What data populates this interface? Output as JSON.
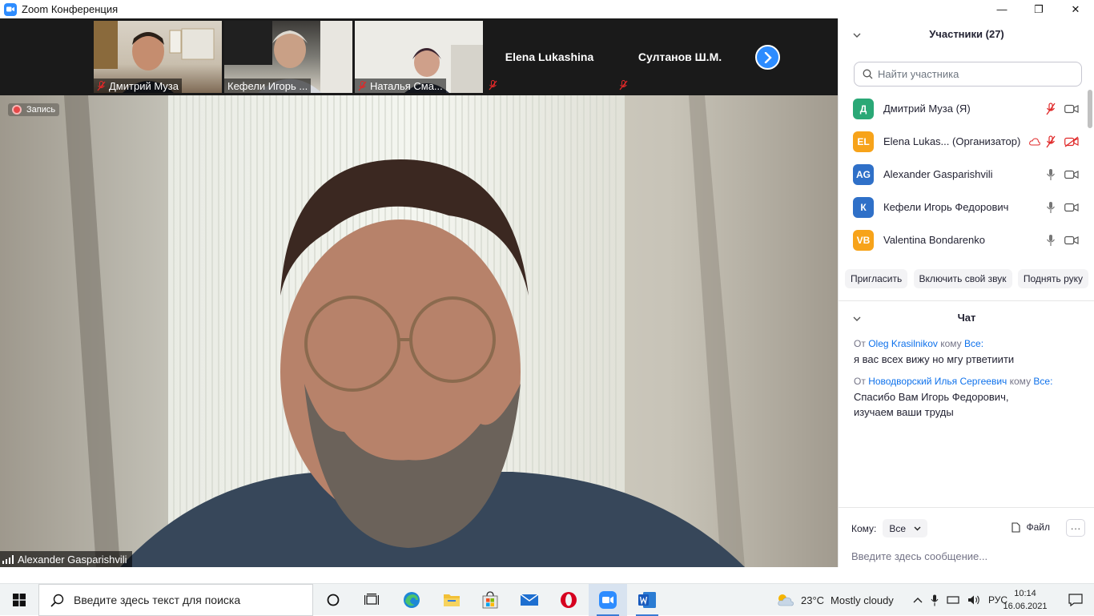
{
  "window": {
    "title": "Zoom Конференция",
    "minimize": "—",
    "maximize": "❐",
    "close": "✕"
  },
  "thumbnails": [
    {
      "name": "Дмитрий Муза"
    },
    {
      "name": "Кефели Игорь ..."
    },
    {
      "name": "Наталья Сма..."
    }
  ],
  "name_tiles": [
    {
      "name": "Elena Lukashina"
    },
    {
      "name": "Султанов Ш.М."
    }
  ],
  "main_video": {
    "recording_label": "Запись",
    "speaker_name": "Alexander Gasparishvili"
  },
  "participants": {
    "header": "Участники (27)",
    "search_placeholder": "Найти участника",
    "items": [
      {
        "initials": "Д",
        "name": "Дмитрий Муза (Я)",
        "color": "#2aa876"
      },
      {
        "initials": "EL",
        "name": "Elena Lukas...   (Организатор)",
        "color": "#f7a31a"
      },
      {
        "initials": "AG",
        "name": "Alexander Gasparishvili",
        "color": "#2f70c8"
      },
      {
        "initials": "К",
        "name": "Кефели Игорь Федорович",
        "color": "#2f70c8"
      },
      {
        "initials": "VB",
        "name": "Valentina Bondarenko",
        "color": "#f7a31a"
      }
    ],
    "actions": {
      "invite": "Пригласить",
      "unmute": "Включить свой звук",
      "raise_hand": "Поднять руку"
    }
  },
  "chat": {
    "header": "Чат",
    "messages": [
      {
        "from_prefix": "От",
        "sender": "Oleg Krasilnikov",
        "to_prefix": "кому",
        "to": "Все:",
        "text": "я вас всех вижу но мгу ртветиити"
      },
      {
        "from_prefix": "От",
        "sender": "Новодворский Илья Сергеевич",
        "to_prefix": "кому",
        "to": "Все:",
        "text": "Спасибо Вам Игорь Федорович, изучаем ваши труды"
      }
    ],
    "to_label": "Кому:",
    "to_value": "Все",
    "file_label": "Файл",
    "more_label": "···",
    "input_placeholder": "Введите здесь сообщение..."
  },
  "taskbar": {
    "search_placeholder": "Введите здесь текст для поиска",
    "weather_temp": "23°C",
    "weather_desc": "Mostly cloudy",
    "lang": "РУС",
    "time": "10:14",
    "date": "16.06.2021"
  },
  "colors": {
    "zoom_blue": "#2d8cff",
    "mute_red": "#e02828",
    "link_blue": "#0e71eb"
  }
}
